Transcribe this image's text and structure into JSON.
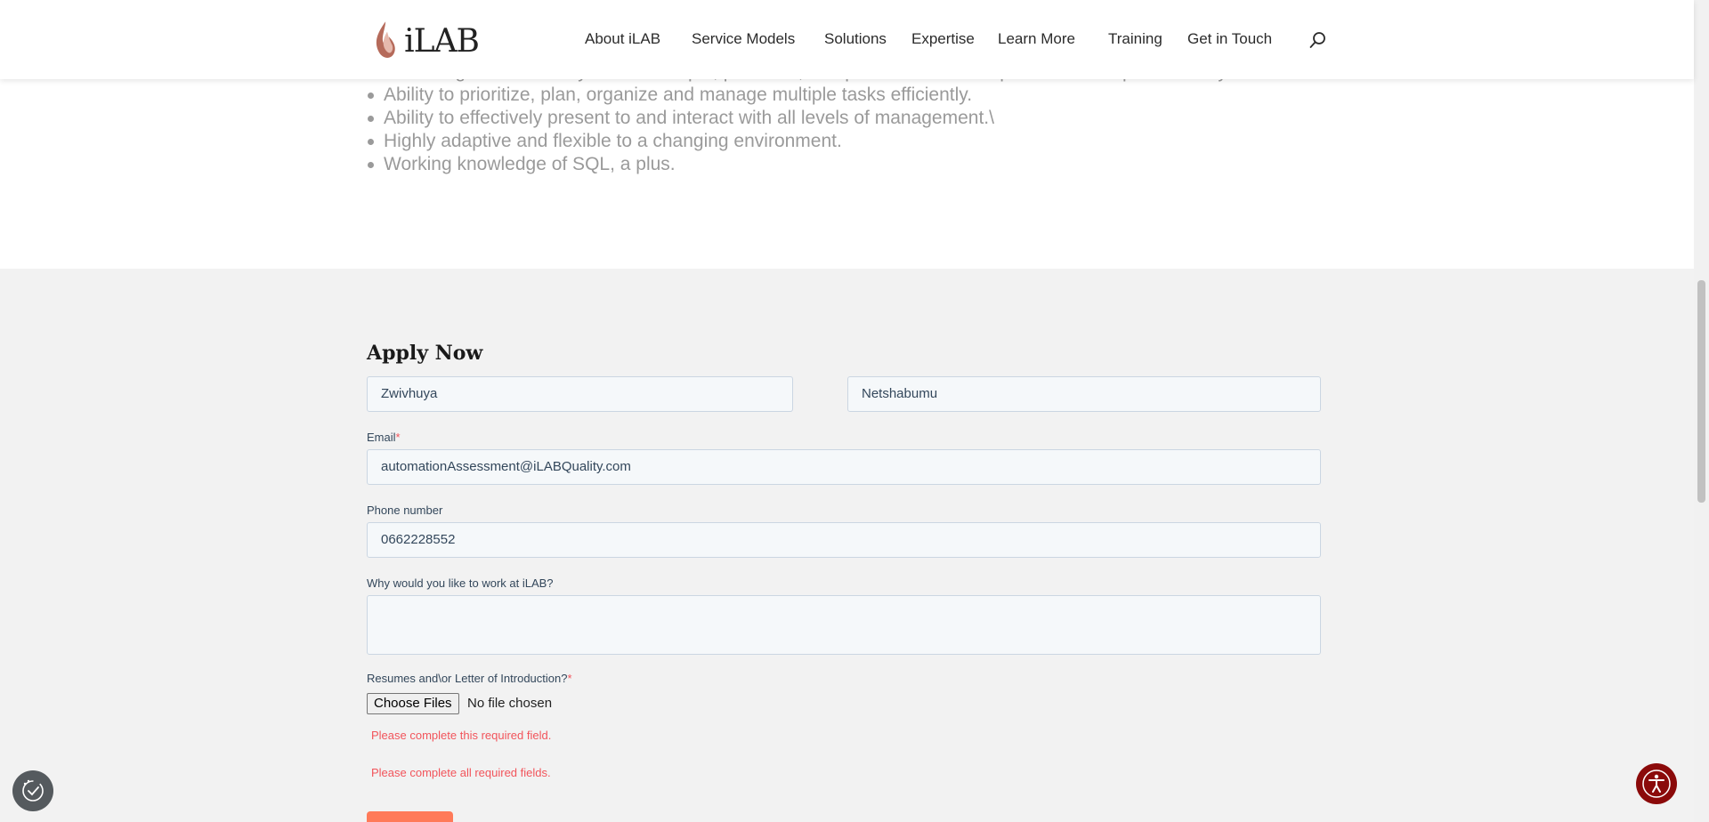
{
  "header": {
    "logo_text": "iLAB",
    "nav": [
      {
        "label": "About iLAB"
      },
      {
        "label": "Service Models"
      },
      {
        "label": "Solutions"
      },
      {
        "label": "Expertise"
      },
      {
        "label": "Learn More"
      },
      {
        "label": "Training"
      },
      {
        "label": "Get in Touch"
      }
    ],
    "search_icon": "search-icon"
  },
  "requirements": {
    "items": [
      "Knowledge of commonly used concepts, practices, and procedures for full product development life cycle desired.",
      "Ability to prioritize, plan, organize and manage multiple tasks efficiently.",
      "Ability to effectively present to and interact with all levels of management.\\",
      "Highly adaptive and flexible to a changing environment.",
      "Working knowledge of SQL, a plus."
    ]
  },
  "form": {
    "title": "Apply Now",
    "first_name": "Zwivhuya",
    "last_name": "Netshabumu",
    "email_label": "Email",
    "email_value": "automationAssessment@iLABQuality.com",
    "phone_label": "Phone number",
    "phone_value": "0662228552",
    "why_label": "Why would you like to work at iLAB?",
    "why_value": "",
    "resume_label": "Resumes and\\or Letter of Introduction?",
    "required_mark": "*",
    "file_button": "Choose Files",
    "file_status": "No file chosen",
    "error_field": "Please complete this required field.",
    "error_form": "Please complete all required fields."
  },
  "colors": {
    "accent": "#ff7a59",
    "error": "#f2545b",
    "accessibility": "#8b0a0a"
  },
  "widgets": {
    "cookie_icon": "cookie-consent-icon",
    "accessibility_icon": "accessibility-icon"
  }
}
